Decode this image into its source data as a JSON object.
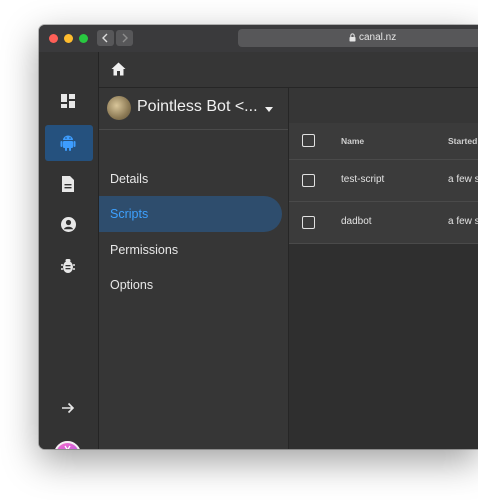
{
  "browser": {
    "url": "canal.nz",
    "lock_icon": "lock-icon"
  },
  "rail": {
    "items": [
      {
        "icon": "dashboard-icon"
      },
      {
        "icon": "android-icon",
        "active": true
      },
      {
        "icon": "document-icon"
      },
      {
        "icon": "account-circle-icon"
      },
      {
        "icon": "bug-icon"
      }
    ],
    "bottom": [
      {
        "icon": "arrow-right-icon"
      },
      {
        "icon": "user-avatar"
      }
    ],
    "accent": "#25517e"
  },
  "appbar": {
    "home_icon": "home-icon"
  },
  "project": {
    "title": "Pointless Bot <...",
    "nav": [
      {
        "label": "Details"
      },
      {
        "label": "Scripts",
        "active": true
      },
      {
        "label": "Permissions"
      },
      {
        "label": "Options"
      }
    ],
    "active_color": "#3da1ff"
  },
  "table": {
    "columns": [
      "Name",
      "Started"
    ],
    "rows": [
      {
        "name": "test-script",
        "started": "a few s"
      },
      {
        "name": "dadbot",
        "started": "a few s"
      }
    ]
  }
}
